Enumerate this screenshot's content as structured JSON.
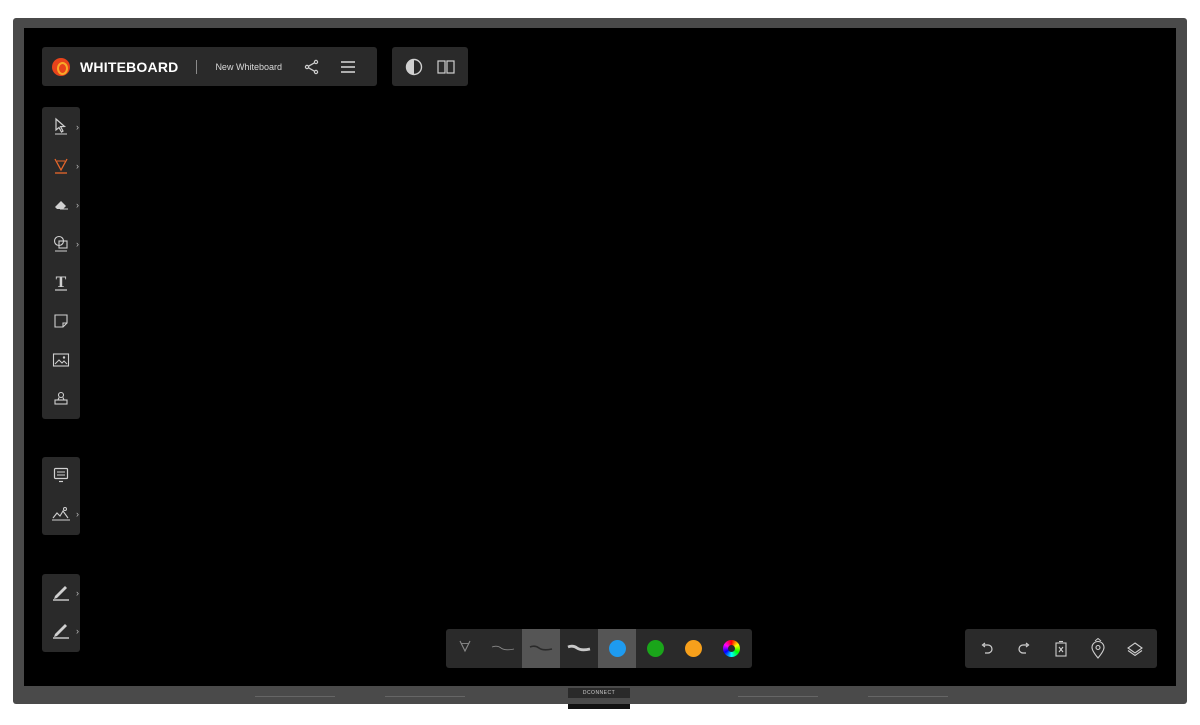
{
  "header": {
    "app_title": "WHITEBOARD",
    "board_name": "New Whiteboard",
    "icons": [
      "logo-icon",
      "share-icon",
      "menu-icon"
    ]
  },
  "view_controls": [
    "contrast-icon",
    "split-view-icon"
  ],
  "left_toolbar": {
    "tools": [
      {
        "name": "select-tool",
        "icon": "cursor-icon",
        "has_submenu": true
      },
      {
        "name": "pen-tool",
        "icon": "pen-icon",
        "has_submenu": true,
        "active": true
      },
      {
        "name": "eraser-tool",
        "icon": "eraser-icon",
        "has_submenu": true
      },
      {
        "name": "shapes-tool",
        "icon": "shapes-icon",
        "has_submenu": true
      },
      {
        "name": "text-tool",
        "icon": "text-icon",
        "has_submenu": false
      },
      {
        "name": "sticky-note-tool",
        "icon": "note-icon",
        "has_submenu": false
      },
      {
        "name": "image-tool",
        "icon": "image-icon",
        "has_submenu": false
      },
      {
        "name": "stamp-tool",
        "icon": "stamp-icon",
        "has_submenu": false
      }
    ],
    "group2": [
      {
        "name": "present-tool",
        "icon": "monitor-icon",
        "has_submenu": false
      },
      {
        "name": "background-tool",
        "icon": "background-icon",
        "has_submenu": true
      }
    ],
    "group3": [
      {
        "name": "pen-a-tool",
        "icon": "pen-a-icon",
        "has_submenu": true
      },
      {
        "name": "pen-b-tool",
        "icon": "pen-b-icon",
        "has_submenu": true
      }
    ]
  },
  "palette": {
    "strokes": [
      "thin",
      "medium",
      "thick"
    ],
    "selected_stroke": "medium",
    "colors": [
      "#1e9bf0",
      "#1aa51a",
      "#f7a01b",
      "multicolor"
    ],
    "selected_color": "#1e9bf0"
  },
  "actions": [
    "undo-icon",
    "redo-icon",
    "clear-icon",
    "location-icon",
    "layers-icon"
  ],
  "bezel": {
    "brand": "DCONNECT"
  }
}
